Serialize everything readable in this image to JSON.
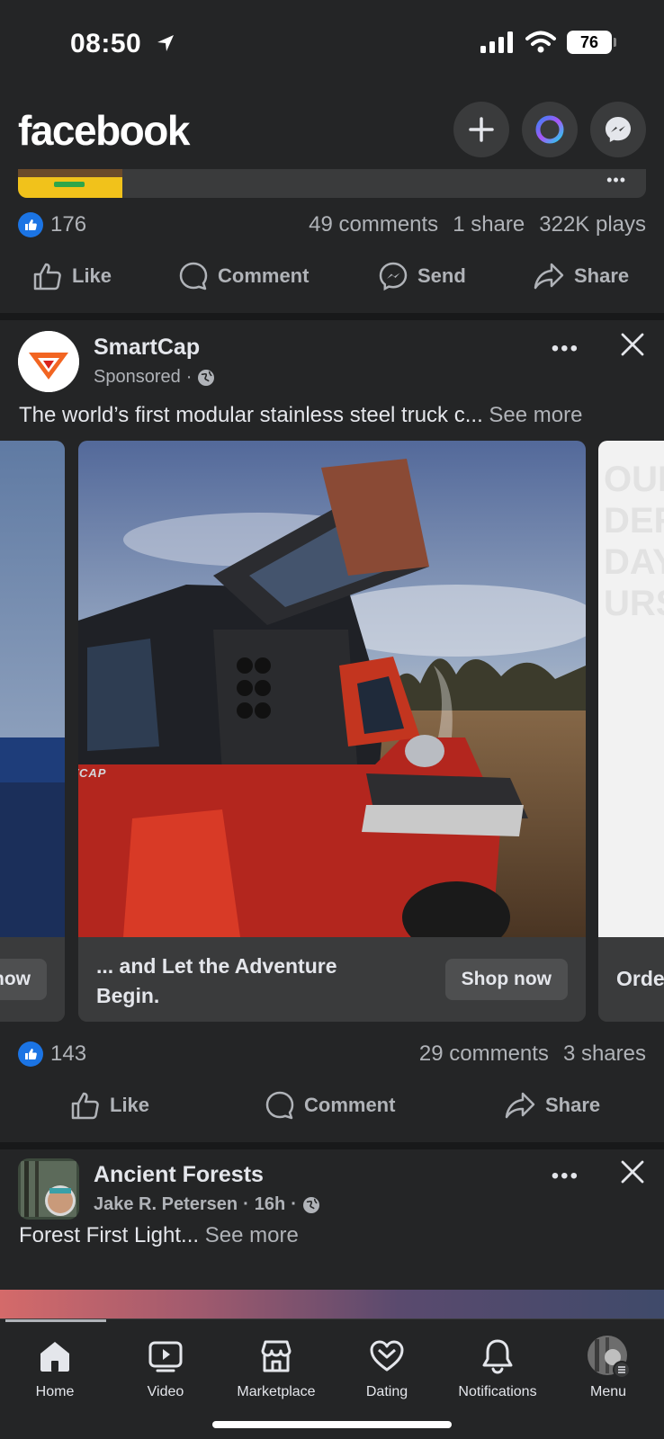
{
  "status_bar": {
    "time": "08:50",
    "battery": "76"
  },
  "header": {
    "logo": "facebook"
  },
  "previous_post": {
    "likes": "176",
    "comments": "49 comments",
    "shares": "1 share",
    "plays": "322K plays",
    "actions": [
      "Like",
      "Comment",
      "Send",
      "Share"
    ]
  },
  "sponsored_post": {
    "page_name": "SmartCap",
    "label": "Sponsored",
    "text": "The world’s first modular stainless steel truck c...",
    "see_more": "See more",
    "cards": [
      {
        "title": "",
        "button": "now"
      },
      {
        "title": "... and Let the Adventure Begin.",
        "button": "Shop now",
        "brand_mark": "SMARTCAP"
      },
      {
        "title": "Orde",
        "button": "",
        "overlay_text": "OUR\nDER\nDAY\nURS"
      }
    ],
    "likes": "143",
    "comments": "29 comments",
    "shares": "3 shares",
    "actions": [
      "Like",
      "Comment",
      "Share"
    ]
  },
  "next_post": {
    "group": "Ancient Forests",
    "author": "Jake R. Petersen",
    "time": "16h",
    "text": "Forest First Light...",
    "see_more": "See more"
  },
  "bottom_nav": {
    "items": [
      {
        "label": "Home",
        "icon": "home-icon",
        "active": true
      },
      {
        "label": "Video",
        "icon": "video-icon"
      },
      {
        "label": "Marketplace",
        "icon": "marketplace-icon"
      },
      {
        "label": "Dating",
        "icon": "dating-icon"
      },
      {
        "label": "Notifications",
        "icon": "bell-icon"
      },
      {
        "label": "Menu",
        "icon": "menu-avatar"
      }
    ]
  },
  "colors": {
    "background": "#242526",
    "accent": "#1b74e4",
    "text": "#e4e6eb",
    "muted": "#b0b3b8"
  }
}
